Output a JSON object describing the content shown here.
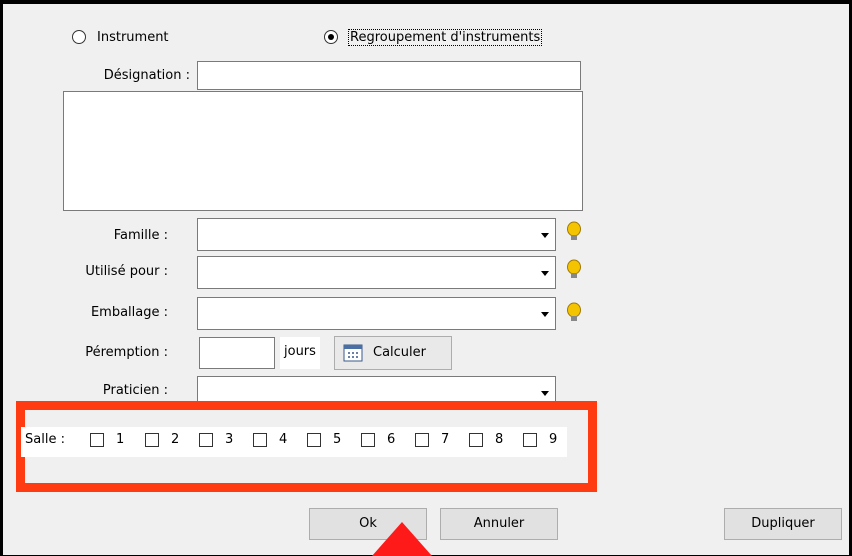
{
  "type_selector": {
    "option_instrument": "Instrument",
    "option_group": "Regroupement d'instruments",
    "selected": "Regroupement d'instruments"
  },
  "designation": {
    "label": "Désignation :",
    "value": "",
    "description": ""
  },
  "famille": {
    "label": "Famille :",
    "value": ""
  },
  "utilise_pour": {
    "label": "Utilisé pour :",
    "value": ""
  },
  "emballage": {
    "label": "Emballage :",
    "value": ""
  },
  "peremption": {
    "label": "Péremption :",
    "value": "",
    "unit": "jours",
    "calc_label": "Calculer"
  },
  "praticien": {
    "label": "Praticien :",
    "value": ""
  },
  "salle": {
    "label": "Salle :",
    "rooms": [
      "1",
      "2",
      "3",
      "4",
      "5",
      "6",
      "7",
      "8",
      "9"
    ]
  },
  "buttons": {
    "ok": "Ok",
    "cancel": "Annuler",
    "duplicate": "Dupliquer"
  },
  "colors": {
    "highlight": "#ff3b12",
    "arrow": "#ff1a1a",
    "bulb": "#f5c400"
  }
}
